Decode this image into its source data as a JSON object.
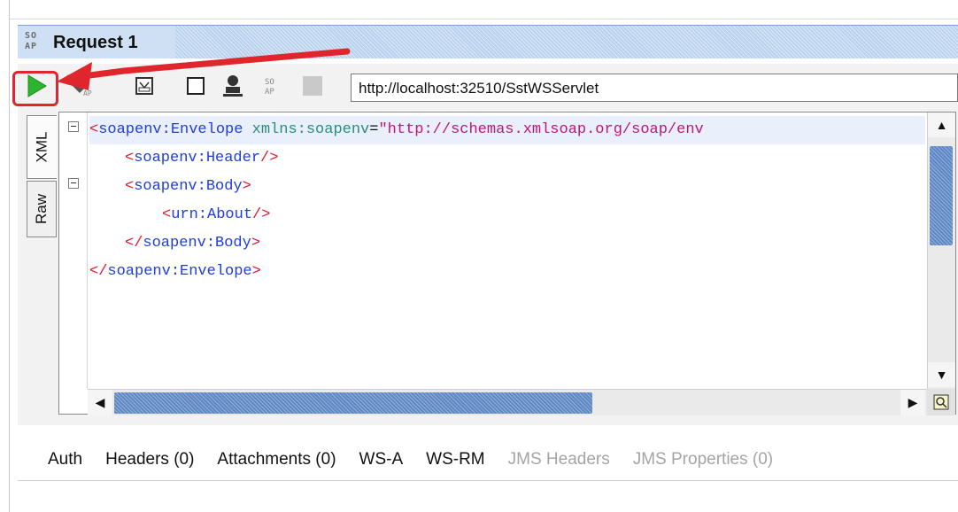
{
  "window": {
    "badge": "SOAP",
    "badge_line1": "SO",
    "badge_line2": "AP",
    "title": "Request 1"
  },
  "toolbar": {
    "buttons": [
      {
        "name": "submit-request-button",
        "icon": "play-icon"
      },
      {
        "name": "create-mock-button",
        "icon": "diamond-soap-icon"
      },
      {
        "name": "clone-request-button",
        "icon": "clone-icon"
      },
      {
        "name": "maximize-editor-button",
        "icon": "square-icon"
      },
      {
        "name": "user-auth-button",
        "icon": "user-icon"
      },
      {
        "name": "soap-format-button",
        "icon": "soap-icon"
      },
      {
        "name": "stop-request-button",
        "icon": "stop-icon"
      }
    ],
    "endpoint_url": "http://localhost:32510/SstWSServlet"
  },
  "editor": {
    "tabs": [
      "XML",
      "Raw"
    ],
    "active_tab": "XML",
    "lines": [
      {
        "open": "<",
        "tag": "soapenv:Envelope",
        "attr": "xmlns:soapenv",
        "eq": "=",
        "value": "\"http://schemas.xmlsoap.org/soap/env",
        "close": ""
      },
      {
        "open": "<",
        "tag": "soapenv:Header",
        "close": "/>"
      },
      {
        "open": "<",
        "tag": "soapenv:Body",
        "close": ">"
      },
      {
        "open": "<",
        "tag": "urn:About",
        "close": "/>"
      },
      {
        "open": "</",
        "tag": "soapenv:Body",
        "close": ">"
      },
      {
        "open": "</",
        "tag": "soapenv:Envelope",
        "close": ">"
      }
    ]
  },
  "bottom_tabs": [
    {
      "label": "Auth",
      "enabled": true
    },
    {
      "label": "Headers (0)",
      "enabled": true
    },
    {
      "label": "Attachments (0)",
      "enabled": true
    },
    {
      "label": "WS-A",
      "enabled": true
    },
    {
      "label": "WS-RM",
      "enabled": true
    },
    {
      "label": "JMS Headers",
      "enabled": false
    },
    {
      "label": "JMS Properties (0)",
      "enabled": false
    }
  ],
  "colors": {
    "title_bar": "#b9d1ee",
    "highlight": "#e0262d",
    "play": "#2db52d",
    "scroll_thumb": "#5d87c4",
    "tag": "#e8142c",
    "tag_name": "#1f3ce0",
    "attr": "#2b8c7c",
    "value": "#c0147a"
  }
}
